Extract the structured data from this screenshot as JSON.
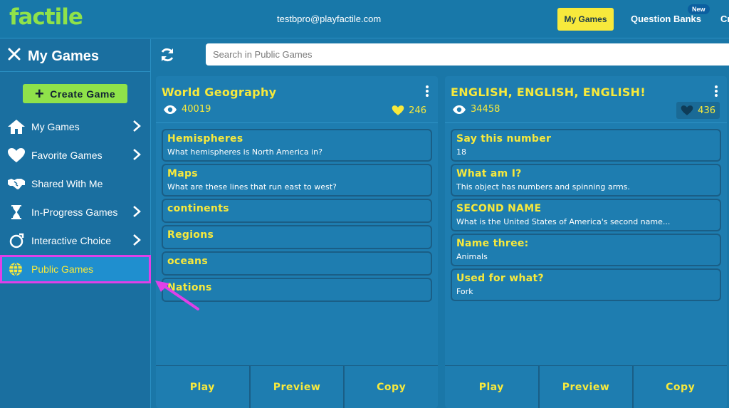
{
  "topbar": {
    "logo": "factile",
    "email": "testbpro@playfactile.com",
    "nav": {
      "my_games": "My Games",
      "question_banks": "Question Banks",
      "new_badge": "New",
      "cut_item": "Cr"
    }
  },
  "sidebar": {
    "title": "My Games",
    "create_button": "Create Game",
    "items": [
      {
        "label": "My Games",
        "icon": "home-icon",
        "has_chevron": true
      },
      {
        "label": "Favorite Games",
        "icon": "heart-icon",
        "has_chevron": true
      },
      {
        "label": "Shared With Me",
        "icon": "handshake-icon",
        "has_chevron": false
      },
      {
        "label": "In-Progress Games",
        "icon": "hourglass-icon",
        "has_chevron": true
      },
      {
        "label": "Interactive Choice",
        "icon": "choice-icon",
        "has_chevron": true
      },
      {
        "label": "Public Games",
        "icon": "globe-icon",
        "has_chevron": false,
        "active": true
      }
    ]
  },
  "search": {
    "placeholder": "Search in Public Games"
  },
  "cards": [
    {
      "title": "World Geography",
      "views": "40019",
      "likes": "246",
      "liked": true,
      "questions": [
        {
          "title": "Hemispheres",
          "subtitle": "What hemispheres is North America in?"
        },
        {
          "title": "Maps",
          "subtitle": "What are these lines that run east to west?"
        },
        {
          "title": "continents",
          "subtitle": ""
        },
        {
          "title": "Regions",
          "subtitle": ""
        },
        {
          "title": "oceans",
          "subtitle": ""
        },
        {
          "title": "Nations",
          "subtitle": ""
        }
      ],
      "actions": {
        "play": "Play",
        "preview": "Preview",
        "copy": "Copy"
      }
    },
    {
      "title": "ENGLISH, ENGLISH, ENGLISH!",
      "views": "34458",
      "likes": "436",
      "liked": false,
      "questions": [
        {
          "title": "Say this number",
          "subtitle": "18"
        },
        {
          "title": "What am I?",
          "subtitle": "This object has numbers and spinning arms."
        },
        {
          "title": "SECOND NAME",
          "subtitle": "What is the United States of America's second name..."
        },
        {
          "title": "Name three:",
          "subtitle": "Animals"
        },
        {
          "title": "Used for what?",
          "subtitle": "Fork"
        }
      ],
      "actions": {
        "play": "Play",
        "preview": "Preview",
        "copy": "Copy"
      }
    }
  ],
  "colors": {
    "accent_yellow": "#f7e93c",
    "brand_green": "#8fe24a",
    "background": "#1a77a8",
    "highlight": "#e040e8"
  }
}
